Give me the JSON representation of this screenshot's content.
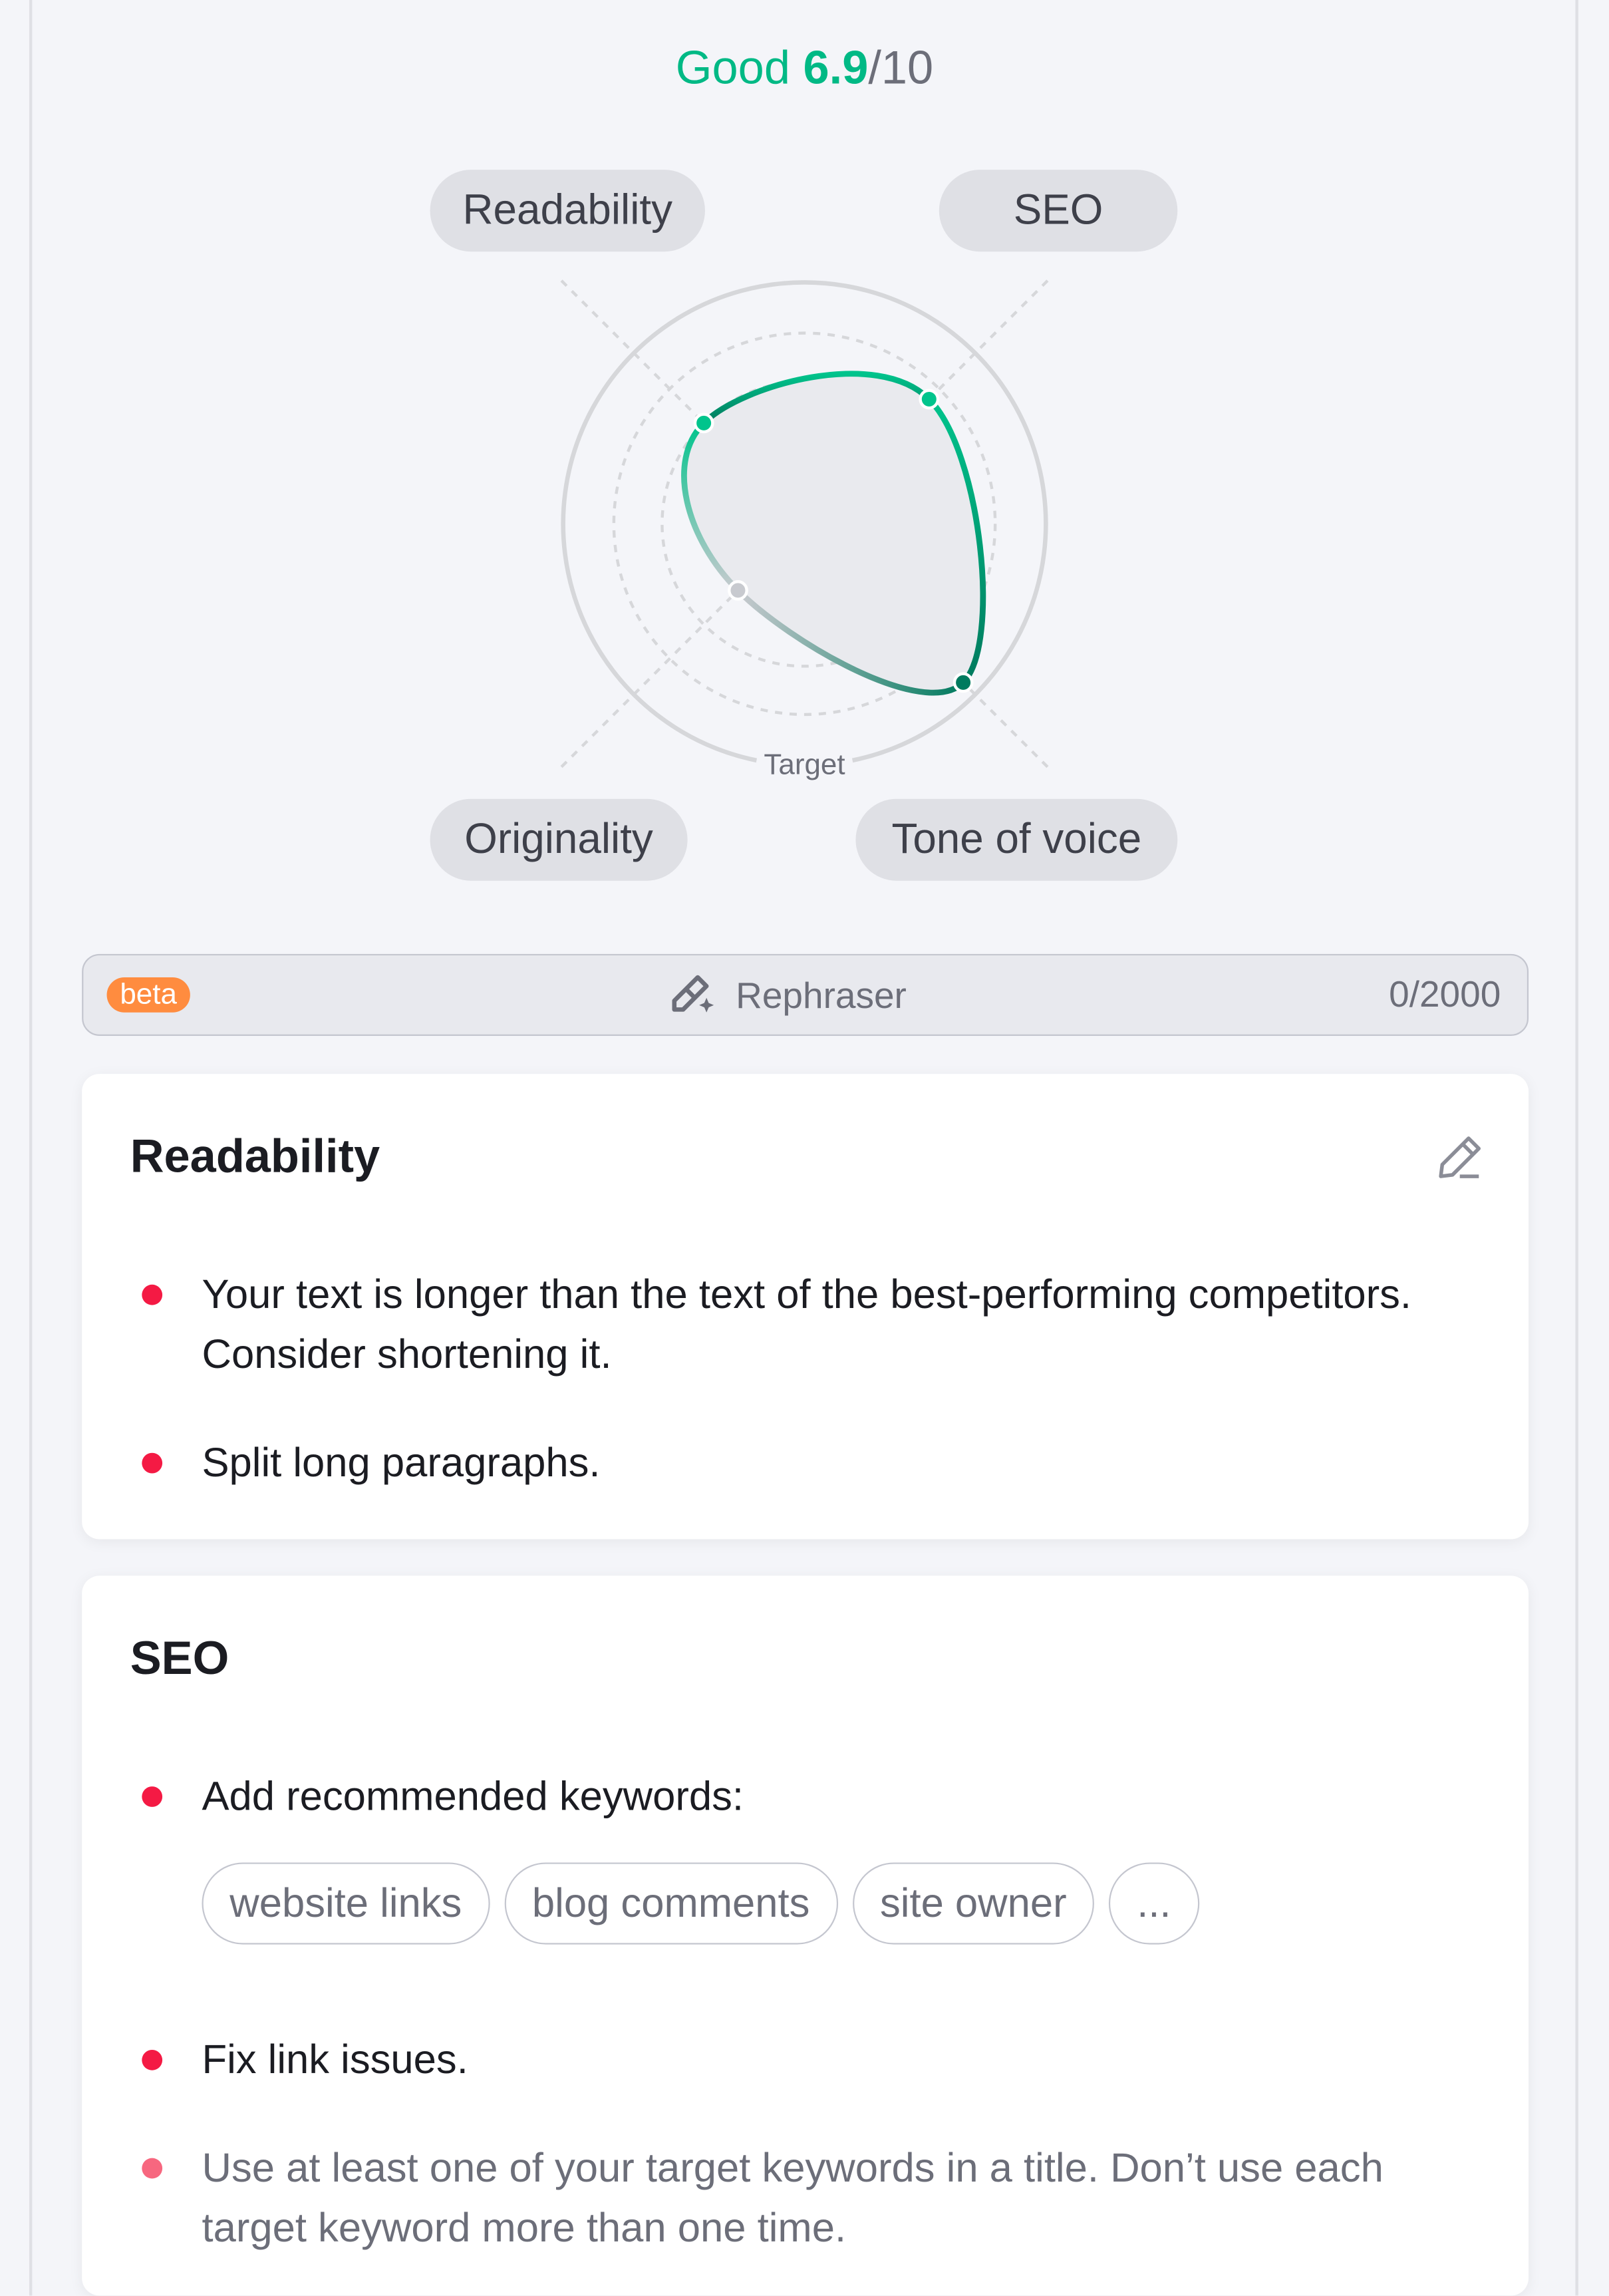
{
  "score": {
    "label": "Good",
    "value": "6.9",
    "max": "/10",
    "color": "#00b985"
  },
  "chart_data": {
    "type": "radar",
    "axes": [
      "Readability",
      "SEO",
      "Tone of voice",
      "Originality"
    ],
    "values": [
      0.59,
      0.73,
      0.93,
      0.39
    ],
    "target_label": "Target",
    "target_value": 1.0
  },
  "rephraser": {
    "badge": "beta",
    "label": "Rephraser",
    "icon": "magic-wand-icon",
    "count": "0/2000"
  },
  "cards": [
    {
      "title": "Readability",
      "icon": "pencil-icon",
      "items": [
        {
          "text": "Your text is longer than the text of the best-performing competitors. Consider shortening it."
        },
        {
          "text": "Split long paragraphs."
        }
      ]
    },
    {
      "title": "SEO",
      "items": [
        {
          "text": "Add recommended keywords:",
          "keywords": [
            "website links",
            "blog comments",
            "site owner",
            "..."
          ]
        },
        {
          "text": "Fix link issues."
        },
        {
          "text": "Use at least one of your target keywords in a title. Don’t use each target keyword more than one time."
        }
      ]
    }
  ],
  "colors": {
    "accent": "#00c48c",
    "accent_dark": "#007a5e",
    "issue_dot": "#f41a44",
    "beta": "#ff8c3f"
  }
}
